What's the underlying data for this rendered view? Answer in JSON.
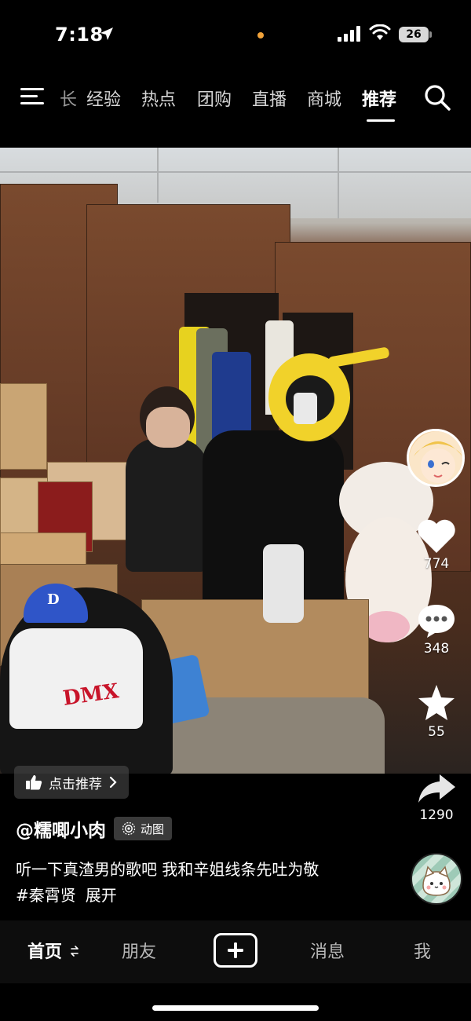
{
  "status_bar": {
    "time": "7:18",
    "battery": "26"
  },
  "top_nav": {
    "partial_tab": "长",
    "tabs": [
      "经验",
      "热点",
      "团购",
      "直播",
      "商城",
      "推荐"
    ],
    "active_tab": "推荐"
  },
  "video": {
    "shirt_text": "DMX",
    "cap_letter": "D"
  },
  "actions": {
    "likes": "774",
    "comments": "348",
    "favorites": "55",
    "shares": "1290"
  },
  "recommend_pill": {
    "label": "点击推荐"
  },
  "post": {
    "author": "@糯唧小肉",
    "badge": "动图",
    "caption_line1": "听一下真渣男的歌吧 我和辛姐线条先吐为敬",
    "hashtag": "#秦霄贤",
    "expand": "展开"
  },
  "tab_bar": {
    "home": "首页",
    "friends": "朋友",
    "messages": "消息",
    "me": "我"
  },
  "colors": {
    "background": "#000000",
    "orange_dot": "#f2a33a",
    "dmx_red": "#c8142a"
  }
}
